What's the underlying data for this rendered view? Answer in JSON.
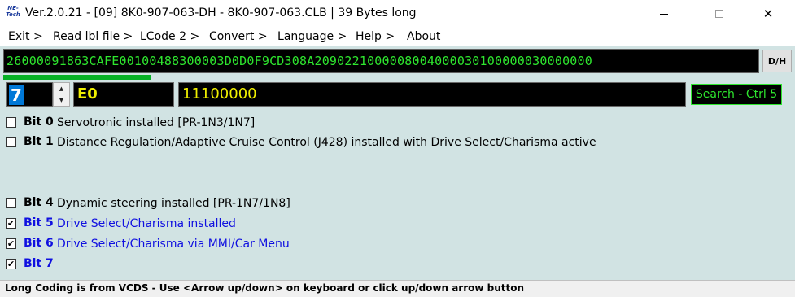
{
  "window": {
    "logo_text": "NE-Tech",
    "title": "Ver.2.0.21 - [09] 8K0-907-063-DH - 8K0-907-063.CLB | 39 Bytes long",
    "minimize_glyph": "",
    "maximize_glyph": "",
    "close_glyph": "✕"
  },
  "menu": {
    "exit": "Exit >",
    "read_lbl": "Read lbl file >",
    "lcode2_prefix": "LCode ",
    "lcode2_num": "2",
    "lcode2_suffix": " >",
    "convert_first": "C",
    "convert_rest": "onvert >",
    "language_first": "L",
    "language_rest": "anguage >",
    "help_first": "H",
    "help_rest": "elp >",
    "about_first": "A",
    "about_rest": "bout"
  },
  "coding": {
    "hex_string": "2600009186 3CAFE00100488300003D0D0F9CD308A2090221000008004000030100000030000000",
    "dh_label": "D/H",
    "progress_fraction": 0.195
  },
  "byte_editor": {
    "byte_index": "7",
    "hex_value": "E0",
    "binary_value": "11100000",
    "search_label": "Search - Ctrl 5",
    "spin_up_glyph": "▲",
    "spin_down_glyph": "▼"
  },
  "bits": [
    {
      "label": "Bit 0",
      "desc": "Servotronic installed [PR-1N3/1N7]",
      "checked": false
    },
    {
      "label": "Bit 1",
      "desc": "Distance Regulation/Adaptive Cruise Control (J428) installed with Drive Select/Charisma active",
      "checked": false
    },
    {
      "label": "Bit 4",
      "desc": "Dynamic steering installed [PR-1N7/1N8]",
      "checked": false
    },
    {
      "label": "Bit 5",
      "desc": "Drive Select/Charisma installed",
      "checked": true
    },
    {
      "label": "Bit 6",
      "desc": "Drive Select/Charisma via MMI/Car Menu",
      "checked": true
    },
    {
      "label": "Bit 7",
      "desc": "",
      "checked": true
    }
  ],
  "checkmark_glyph": "✔",
  "status": {
    "text": "Long Coding is from VCDS - Use <Arrow up/down> on keyboard or click up/down arrow button"
  },
  "colors": {
    "background": "#d1e3e3",
    "hex_text": "#2ee62e",
    "byte_text": "#f0f000",
    "active_bit": "#1010e0",
    "selection": "#0078d7",
    "progress": "#06b025"
  }
}
